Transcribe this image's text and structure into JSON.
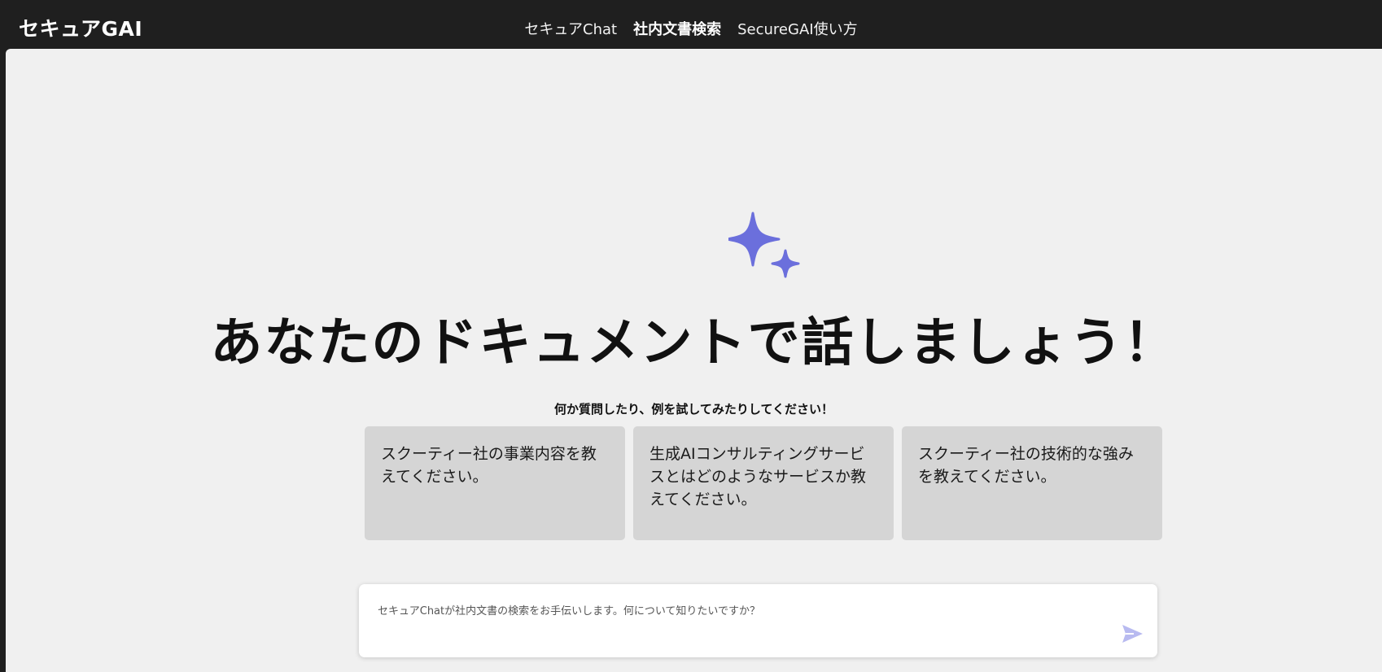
{
  "header": {
    "brand": "セキュアGAI",
    "nav": [
      {
        "label": "セキュアChat",
        "active": false
      },
      {
        "label": "社内文書検索",
        "active": true
      },
      {
        "label": "SecureGAI使い方",
        "active": false
      }
    ]
  },
  "main": {
    "icon": "sparkle-icon",
    "headline": "あなたのドキュメントで話しましょう！",
    "subhead": "何か質問したり、例を試してみたりしてください！",
    "examples": [
      "スクーティー社の事業内容を教えてください。",
      "生成AIコンサルティングサービスとはどのようなサービスか教えてください。",
      "スクーティー社の技術的な強みを教えてください。"
    ]
  },
  "chat": {
    "placeholder": "セキュアChatが社内文書の検索をお手伝いします。何について知りたいですか？",
    "value": "",
    "send_icon": "send-icon"
  },
  "colors": {
    "topbar": "#1f1f1f",
    "background": "#f0f0f0",
    "card": "#d5d5d5",
    "accent": "#6b6fdc",
    "send_disabled": "#b8baf0"
  }
}
